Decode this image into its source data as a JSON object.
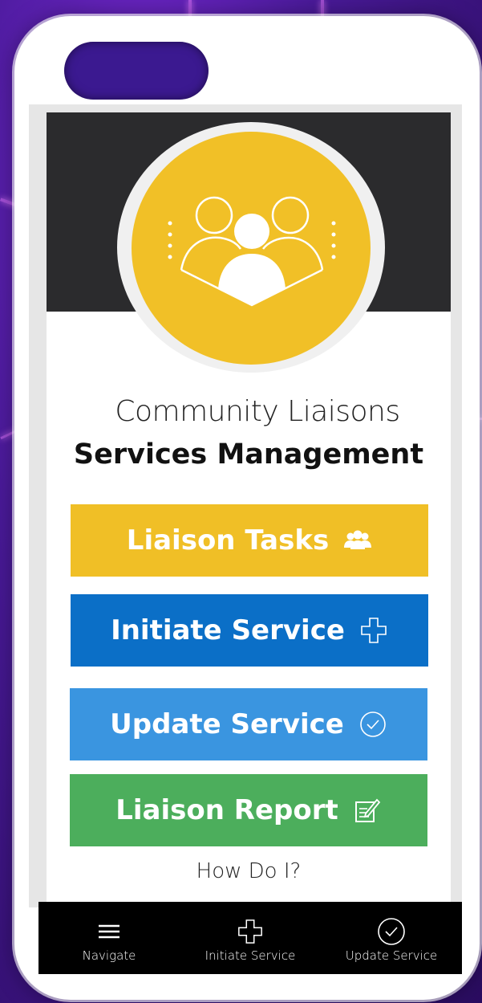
{
  "app": {
    "title_line1": "Community Liaisons",
    "title_line2": "Services Management"
  },
  "buttons": {
    "liaison_tasks": "Liaison Tasks",
    "initiate_service": "Initiate Service",
    "update_service": "Update Service",
    "liaison_report": "Liaison Report"
  },
  "help_link": "How Do I?",
  "bottom_nav": {
    "navigate": "Navigate",
    "initiate_service": "Initiate Service",
    "update_service": "Update Service"
  },
  "icons": {
    "logo": "community-group-icon",
    "liaison_tasks": "users-icon",
    "initiate_service": "plus-outline-icon",
    "update_service": "check-circle-icon",
    "liaison_report": "edit-document-icon",
    "navigate": "hamburger-menu-icon"
  },
  "colors": {
    "brand_yellow": "#f1c027",
    "initiate_blue": "#0b6fc7",
    "update_blue": "#3a95e0",
    "report_green": "#4cae5c",
    "header_dark": "#2b2b2d"
  }
}
